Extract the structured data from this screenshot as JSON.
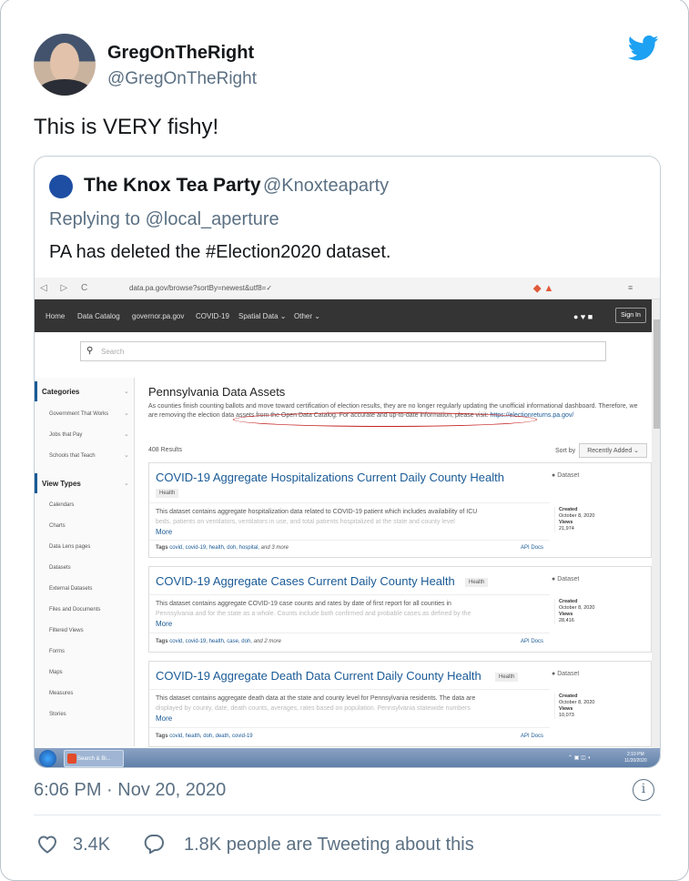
{
  "tweet": {
    "display_name": "GregOnTheRight",
    "handle": "@GregOnTheRight",
    "text": "This is VERY fishy!",
    "timestamp": "6:06 PM · Nov 20, 2020",
    "likes": "3.4K",
    "reply_text": "1.8K people are Tweeting about this",
    "info_glyph": "i",
    "brand_color": "#1da1f2"
  },
  "quote": {
    "display_name": "The Knox Tea Party",
    "handle": "@Knoxteaparty",
    "replying": "Replying to @local_aperture",
    "text": "PA has deleted the #Election2020  dataset."
  },
  "screenshot": {
    "browser": {
      "nav": "◁ ▷ C",
      "url": "data.pa.gov/browse?sortBy=newest&utf8=✓",
      "menu": "≡"
    },
    "site_nav": [
      "Home",
      "Data Catalog",
      "governor.pa.gov",
      "COVID-19",
      "Spatial Data ⌄",
      "Other ⌄"
    ],
    "social": "● ♥ ■",
    "sign_in": "Sign In",
    "search_placeholder": "Search",
    "sidebar": {
      "categories_heading": "Categories",
      "categories": [
        "Government That Works",
        "Jobs that Pay",
        "Schools that Teach"
      ],
      "view_types_heading": "View Types",
      "view_types": [
        "Calendars",
        "Charts",
        "Data Lens pages",
        "Datasets",
        "External Datasets",
        "Files and Documents",
        "Filtered Views",
        "Forms",
        "Maps",
        "Measures",
        "Stories"
      ]
    },
    "page_title": "Pennsylvania Data Assets",
    "desc_1": "As counties finish counting ballots and move toward certification of election results, they are no longer regularly updating the unofficial informational dashboard. ",
    "desc_highlight": "Therefore, we are removing the election data assets from the Open Data Catalog.",
    "desc_2": " For accurate and up-to-date information, please visit: ",
    "desc_link": "https://electionreturns.pa.gov/",
    "results": "408 Results",
    "sort_label": "Sort by",
    "sort_value": "Recently Added ⌄",
    "cards": [
      {
        "title": "COVID-19 Aggregate Hospitalizations Current Daily County Health",
        "badge": "Health",
        "type": "Dataset",
        "desc": "This dataset contains aggregate hospitalization data related to COVID-19 patient which includes availability of ICU",
        "desc_fade": "beds, patients on ventilators, ventilators in use, and total patients hospitalized at the state and county level",
        "more": "More",
        "tags_label": "Tags",
        "tags": "covid, covid-19, health, doh, hospital,",
        "tags_more": "and 3 more",
        "api": "API Docs",
        "created_label": "Created",
        "created": "October 8, 2020",
        "views_label": "Views",
        "views": "21,974"
      },
      {
        "title": "COVID-19 Aggregate Cases Current Daily County Health",
        "badge": "Health",
        "type": "Dataset",
        "desc": "This dataset contains aggregate COVID-19 case counts and rates by date of first report for all counties in",
        "desc_fade": "Pennsylvania and for the state as a whole. Counts include both confirmed and probable cases as defined by the",
        "more": "More",
        "tags_label": "Tags",
        "tags": "covid, covid-19, health, case, doh,",
        "tags_more": "and 2 more",
        "api": "API Docs",
        "created_label": "Created",
        "created": "October 8, 2020",
        "views_label": "Views",
        "views": "28,416"
      },
      {
        "title": "COVID-19 Aggregate Death Data Current Daily County Health",
        "badge": "Health",
        "type": "Dataset",
        "desc": "This dataset contains aggregate death data at the state and county level for Pennsylvania residents. The data are",
        "desc_fade": "displayed by county, date, death counts, averages, rates based on population. Pennsylvania statewide numbers",
        "more": "More",
        "tags_label": "Tags",
        "tags": "covid, health, doh, death, covid-19",
        "tags_more": "",
        "api": "API Docs",
        "created_label": "Created",
        "created": "October 8, 2020",
        "views_label": "Views",
        "views": "10,073"
      }
    ],
    "taskbar": {
      "item": "Search & Bi...",
      "tray": "⌃ ▣ ◫ ◖",
      "time": "2:10 PM",
      "date": "11/20/2020"
    }
  }
}
